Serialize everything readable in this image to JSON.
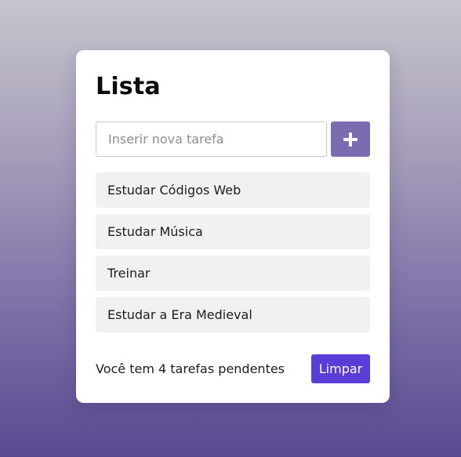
{
  "card": {
    "title": "Lista"
  },
  "input": {
    "placeholder": "Inserir nova tarefa",
    "value": ""
  },
  "add_button": {
    "icon": "plus-icon"
  },
  "tasks": [
    {
      "label": "Estudar Códigos Web"
    },
    {
      "label": "Estudar Música"
    },
    {
      "label": "Treinar"
    },
    {
      "label": "Estudar a Era Medieval"
    }
  ],
  "footer": {
    "pending_text": "Você tem 4 tarefas pendentes",
    "clear_label": "Limpar"
  },
  "colors": {
    "accent": "#7b6bb1",
    "clear_button": "#5a3cd7",
    "task_background": "#f1f1f1",
    "background_top": "#c7c5cc",
    "background_bottom": "#594a90"
  }
}
